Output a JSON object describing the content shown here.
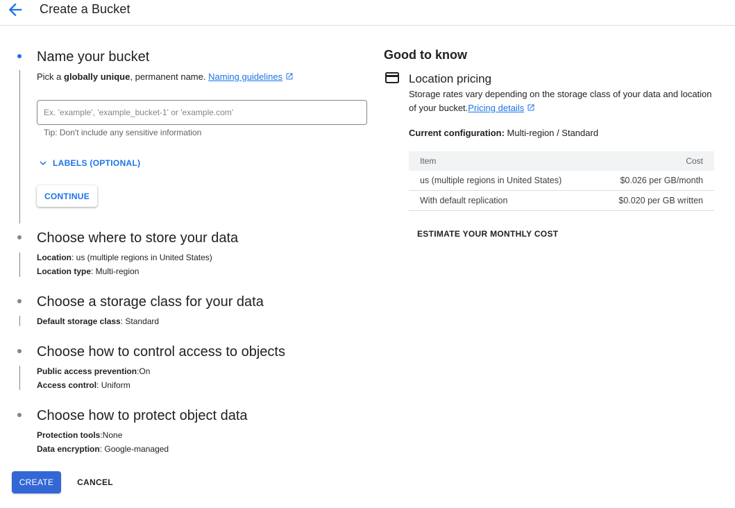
{
  "header": {
    "title": "Create a Bucket"
  },
  "step1": {
    "title": "Name your bucket",
    "subtitle_prefix": "Pick a ",
    "subtitle_bold": "globally unique",
    "subtitle_suffix": ", permanent name. ",
    "naming_link": "Naming guidelines",
    "input_placeholder": "Ex. 'example', 'example_bucket-1' or 'example.com'",
    "input_value": "",
    "tip": "Tip: Don't include any sensitive information",
    "labels_toggle": "LABELS (OPTIONAL)",
    "continue_label": "CONTINUE"
  },
  "step2": {
    "title": "Choose where to store your data",
    "line1_key": "Location",
    "line1_value": ": us (multiple regions in United States)",
    "line2_key": "Location type",
    "line2_value": ": Multi-region"
  },
  "step3": {
    "title": "Choose a storage class for your data",
    "line1_key": "Default storage class",
    "line1_value": ": Standard"
  },
  "step4": {
    "title": "Choose how to control access to objects",
    "line1_key": "Public access prevention",
    "line1_value": ":On",
    "line2_key": "Access control",
    "line2_value": ": Uniform"
  },
  "step5": {
    "title": "Choose how to protect object data",
    "line1_key": "Protection tools",
    "line1_value": ":None",
    "line2_key": "Data encryption",
    "line2_value": ": Google-managed"
  },
  "actions": {
    "create_label": "CREATE",
    "cancel_label": "CANCEL"
  },
  "good_to_know": {
    "title": "Good to know",
    "location_pricing_title": "Location pricing",
    "description": "Storage rates vary depending on the storage class of your data and location of your bucket.",
    "pricing_link": "Pricing details",
    "config_key": "Current configuration:",
    "config_value": " Multi-region / Standard",
    "table": {
      "headers": [
        "Item",
        "Cost"
      ],
      "rows": [
        [
          "us (multiple regions in United States)",
          "$0.026 per GB/month"
        ],
        [
          "With default replication",
          "$0.020 per GB written"
        ]
      ]
    },
    "estimate_label": "ESTIMATE YOUR MONTHLY COST"
  },
  "colors": {
    "accent": "#1a73e8",
    "primary_button": "#3367d6",
    "step_inactive": "#80868b"
  },
  "icons": {
    "back": "arrow-back-icon",
    "external_link": "open-in-new-icon",
    "expand": "chevron-down-icon",
    "card": "credit-card-icon"
  }
}
